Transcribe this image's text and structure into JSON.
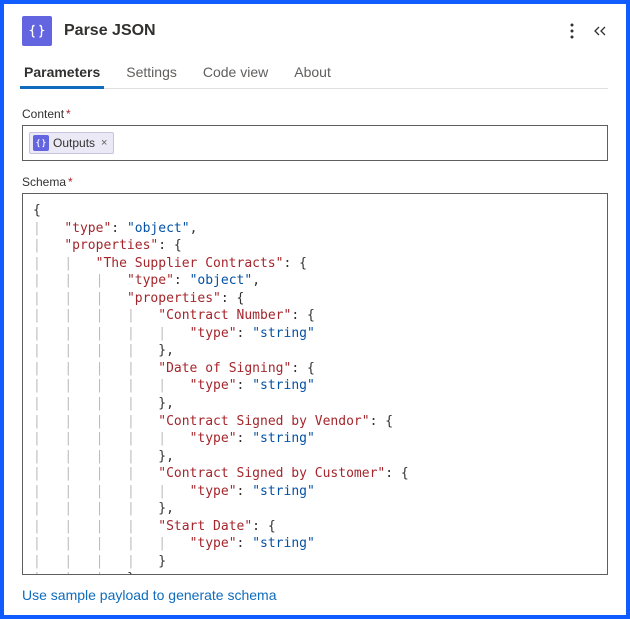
{
  "header": {
    "title": "Parse JSON",
    "icon_name": "json-braces-icon"
  },
  "tabs": {
    "items": [
      {
        "label": "Parameters",
        "active": true
      },
      {
        "label": "Settings",
        "active": false
      },
      {
        "label": "Code view",
        "active": false
      },
      {
        "label": "About",
        "active": false
      }
    ]
  },
  "content_field": {
    "label": "Content",
    "required": true,
    "chip_label": "Outputs",
    "chip_close": "×"
  },
  "schema_field": {
    "label": "Schema",
    "required": true,
    "value": {
      "type": "object",
      "properties": {
        "The Supplier Contracts": {
          "type": "object",
          "properties": {
            "Contract Number": {
              "type": "string"
            },
            "Date of Signing": {
              "type": "string"
            },
            "Contract Signed by Vendor": {
              "type": "string"
            },
            "Contract Signed by Customer": {
              "type": "string"
            },
            "Start Date": {
              "type": "string"
            }
          }
        }
      }
    }
  },
  "footer": {
    "generate_link": "Use sample payload to generate schema"
  }
}
